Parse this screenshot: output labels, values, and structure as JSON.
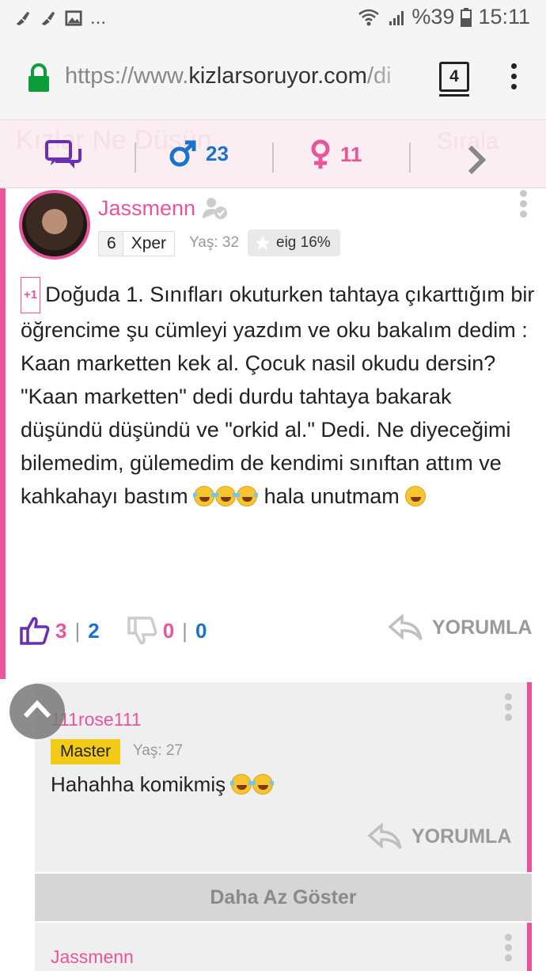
{
  "status_bar": {
    "left_more": "...",
    "battery": "%39",
    "time": "15:11"
  },
  "browser": {
    "url_prefix": "https://www.",
    "url_domain": "kizlarsoruyor.com",
    "url_suffix": "/di",
    "tab_count": "4"
  },
  "filter_bar": {
    "ghost_left": "Kızlar Ne Düşün",
    "ghost_right": "Sırala",
    "male_count": "23",
    "female_count": "11"
  },
  "post": {
    "username": "Jassmenn",
    "level_number": "6",
    "level_name": "Xper",
    "age": "Yaş: 32",
    "eig": "eig 16%",
    "plus_badge": "+1",
    "paragraph1": "Doğuda 1. Sınıfları okuturken tahtaya çıkarttığım bir öğrencime şu cümleyi yazdım ve oku bakalım dedim : Kaan marketten kek al. Çocuk nasil okudu dersin?",
    "paragraph2_start": "\"Kaan marketten\" dedi durdu tahtaya bakarak düşündü düşündü ve \"orkid al.\" Dedi. Ne diyeceğimi bilemedim, gülemedim de kendimi sınıftan attım ve kahkahayı bastım",
    "paragraph2_end": "hala unutmam",
    "likes": "3",
    "likes_extra": "2",
    "dislikes": "0",
    "dislikes_extra": "0",
    "reply_label": "YORUMLA"
  },
  "comment": {
    "username": "111rose111",
    "badge": "Master",
    "age": "Yaş: 27",
    "text": "Hahahha komikmiş",
    "reply_label": "YORUMLA"
  },
  "show_less": "Daha Az Göster",
  "comment2": {
    "username": "Jassmenn"
  },
  "colors": {
    "pink": "#e8559a",
    "blue": "#1a73c8",
    "master_yellow": "#f2cb16"
  }
}
